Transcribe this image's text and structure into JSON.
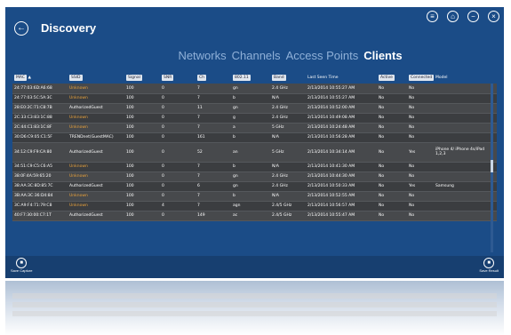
{
  "header": {
    "title": "Discovery",
    "back_icon": "arrow-left-icon",
    "top_icons": [
      "menu-icon",
      "home-icon",
      "minimize-icon",
      "close-icon"
    ]
  },
  "tabs": [
    {
      "label": "Networks",
      "active": false
    },
    {
      "label": "Channels",
      "active": false
    },
    {
      "label": "Access Points",
      "active": false
    },
    {
      "label": "Clients",
      "active": true
    }
  ],
  "table": {
    "columns": [
      "MAC",
      "SSID",
      "Signal",
      "SNR",
      "Ch",
      "802.11",
      "Band",
      "Last Seen Time",
      "Active",
      "Connected",
      "Model"
    ],
    "rows": [
      [
        "24:77:03:6D:A6:68",
        "Unknown",
        "100",
        "0",
        "7",
        "gn",
        "2.4 GHz",
        "2/13/2014 10:55:27 AM",
        "No",
        "No",
        ""
      ],
      [
        "24:77:03:5C:5A:3C",
        "Unknown",
        "100",
        "0",
        "7",
        "b",
        "N/A",
        "2/13/2014 10:55:27 AM",
        "No",
        "No",
        ""
      ],
      [
        "28:E0:2C:71:C8:7B",
        "AuthorizedGuest",
        "100",
        "0",
        "11",
        "gn",
        "2.4 GHz",
        "2/13/2014 10:52:00 AM",
        "No",
        "No",
        ""
      ],
      [
        "2C:33:C3:83:1C:88",
        "Unknown",
        "100",
        "0",
        "7",
        "g",
        "2.4 GHz",
        "2/13/2014 10:49:08 AM",
        "No",
        "No",
        ""
      ],
      [
        "2C:44:C1:83:1C:8F",
        "Unknown",
        "100",
        "0",
        "7",
        "a",
        "5 GHz",
        "2/13/2014 10:24:48 AM",
        "No",
        "No",
        ""
      ],
      [
        "30:D6:C9:05:C1:5F",
        "TRENDnet(GuestMAC)",
        "100",
        "0",
        "161",
        "b",
        "N/A",
        "2/13/2014 10:56:28 AM",
        "No",
        "No",
        ""
      ],
      [
        "34:12:C9:F9:CA:80",
        "AuthorizedGuest",
        "100",
        "0",
        "52",
        "an",
        "5 GHz",
        "2/13/2014 10:34:14 AM",
        "No",
        "Yes",
        "iPhone 4/ iPhone 4s/iPad 1,2,3"
      ],
      [
        "34:51:C9:C5:C6:A5",
        "Unknown",
        "100",
        "0",
        "7",
        "b",
        "N/A",
        "2/13/2014 10:41:30 AM",
        "No",
        "No",
        ""
      ],
      [
        "38:0F:4A:59:65:20",
        "Unknown",
        "100",
        "0",
        "7",
        "gn",
        "2.4 GHz",
        "2/13/2014 10:44:30 AM",
        "No",
        "No",
        ""
      ],
      [
        "38:AA:3C:8D:85:7C",
        "AuthorizedGuest",
        "100",
        "0",
        "6",
        "gn",
        "2.4 GHz",
        "2/13/2014 10:50:33 AM",
        "No",
        "Yes",
        "Samsung"
      ],
      [
        "3B:AA:3C:36:D4:84",
        "Unknown",
        "100",
        "0",
        "7",
        "b",
        "N/A",
        "2/13/2014 10:52:55 AM",
        "No",
        "No",
        ""
      ],
      [
        "3C:A9:F4:71:79:C8",
        "Unknown",
        "100",
        "4",
        "7",
        "agn",
        "2.4/5 GHz",
        "2/13/2014 10:56:57 AM",
        "No",
        "No",
        ""
      ],
      [
        "40:F7:30:00:C7:1T",
        "AuthorizedGuest",
        "100",
        "0",
        "149",
        "ac",
        "2.4/5 GHz",
        "2/13/2014 10:55:47 AM",
        "No",
        "No",
        ""
      ]
    ]
  },
  "appbar": {
    "left": {
      "label": "Save Capture",
      "icon": "save-capture-icon"
    },
    "right": {
      "label": "Save Result",
      "icon": "save-result-icon"
    }
  },
  "colors": {
    "background": "#1b4c87",
    "row_odd": "#47494c",
    "row_even": "#3b3d40",
    "unknown_text": "#e9a23b",
    "appbar": "#173f70"
  }
}
